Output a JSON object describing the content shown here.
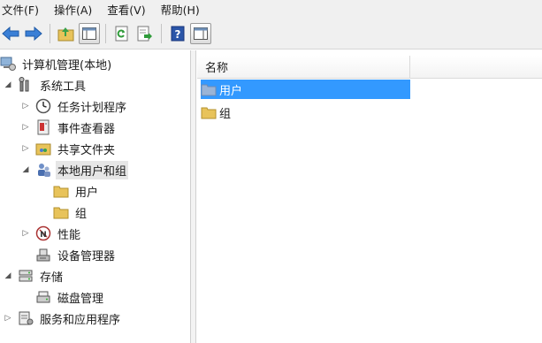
{
  "menu": {
    "file": "文件(F)",
    "action": "操作(A)",
    "view": "查看(V)",
    "help": "帮助(H)"
  },
  "tree": {
    "root": "计算机管理(本地)",
    "system_tools": "系统工具",
    "task_scheduler": "任务计划程序",
    "event_viewer": "事件查看器",
    "shared_folders": "共享文件夹",
    "local_users_groups": "本地用户和组",
    "users": "用户",
    "groups": "组",
    "performance": "性能",
    "device_manager": "设备管理器",
    "storage": "存储",
    "disk_management": "磁盘管理",
    "services_apps": "服务和应用程序"
  },
  "list": {
    "column_name": "名称",
    "items": [
      "用户",
      "组"
    ]
  },
  "colors": {
    "selection": "#3399ff",
    "folder": "#e8c35a",
    "toolbar_bg": "#f0f0f0"
  }
}
